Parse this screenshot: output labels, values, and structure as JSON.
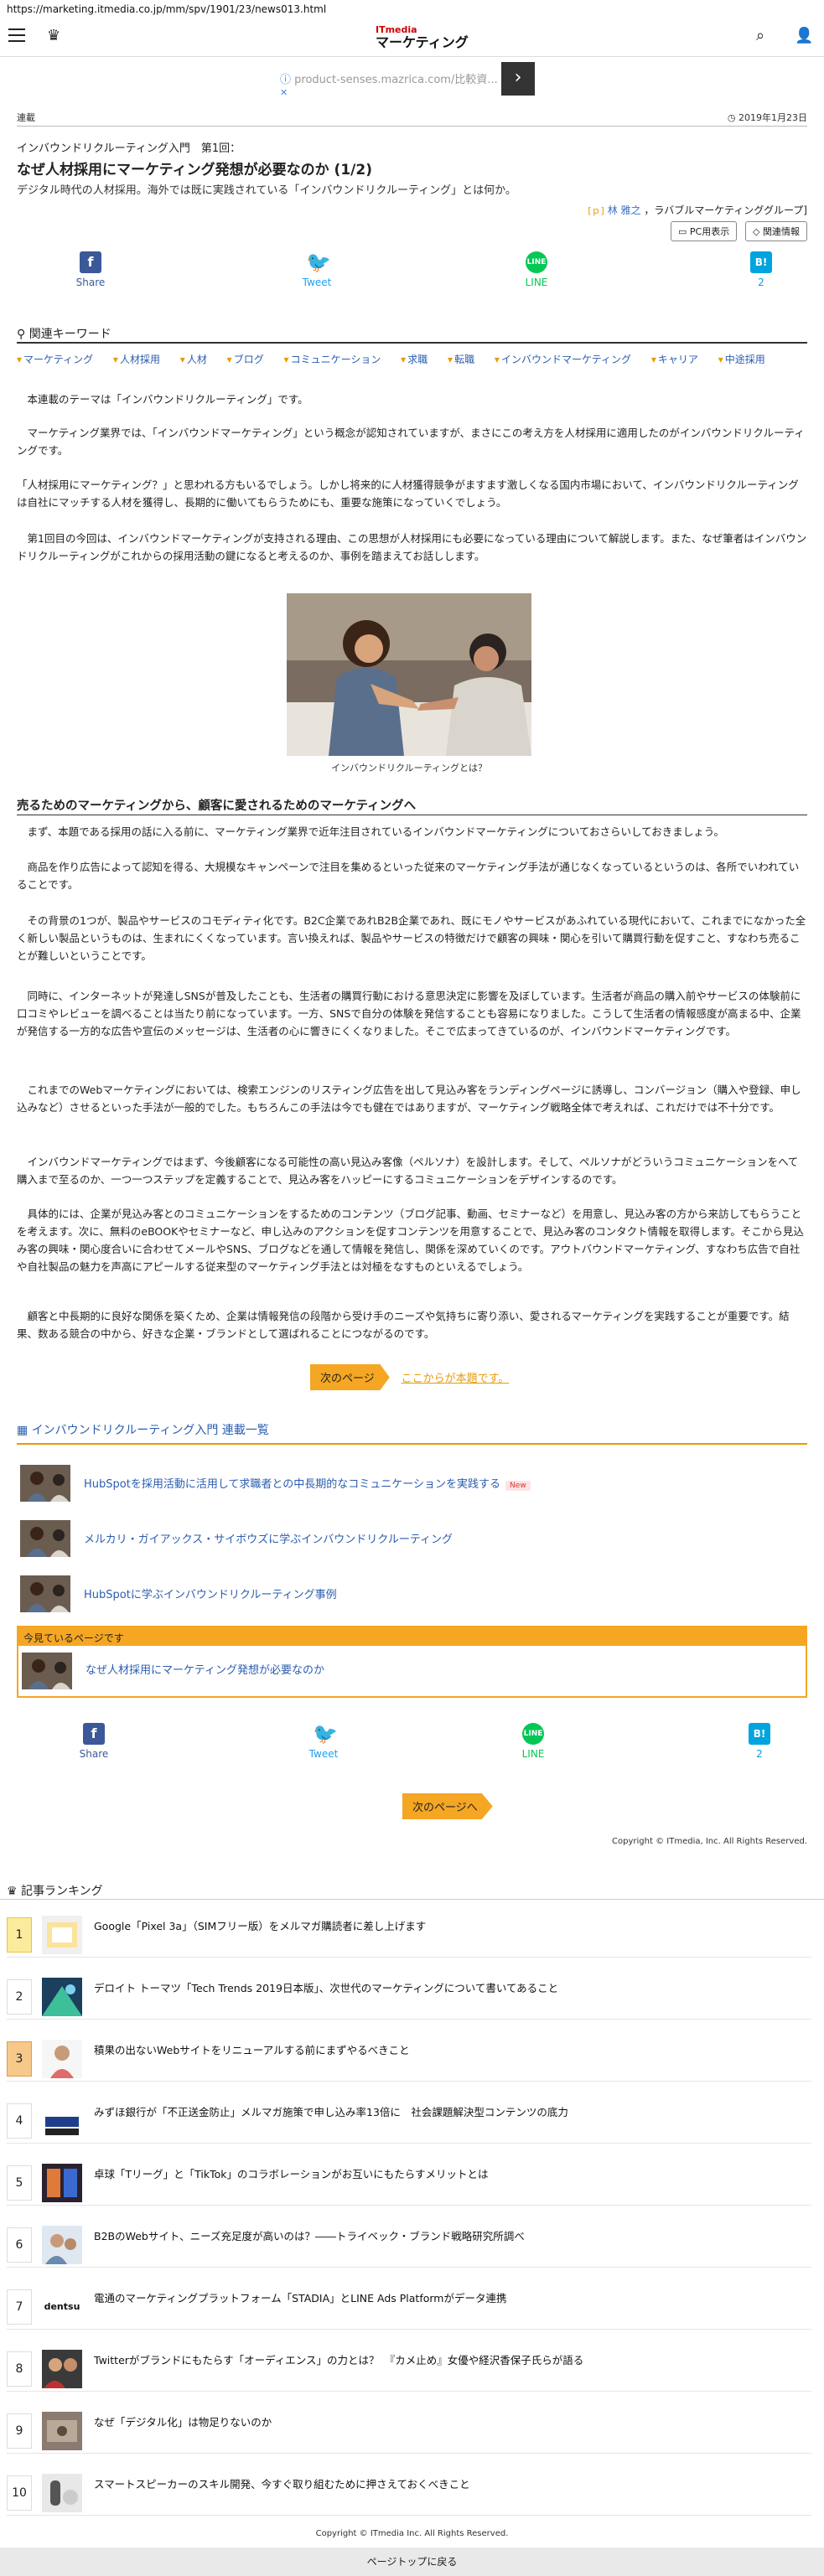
{
  "browser": {
    "url": "https://marketing.itmedia.co.jp/mm/spv/1901/23/news013.html"
  },
  "header": {
    "logo_top": "ITmedia",
    "logo_main": "マーケティング"
  },
  "ad": {
    "text": "product-senses.mazrica.com/比較資...",
    "info": "ⓘ",
    "close": "✕"
  },
  "meta": {
    "category": "連載",
    "date": "2019年1月23日"
  },
  "article": {
    "series": "インバウンドリクルーティング入門　第1回：",
    "title": "なぜ人材採用にマーケティング発想が必要なのか (1/2)",
    "subtitle": "デジタル時代の人材採用。海外では既に実践されている「インバウンドリクルーティング」とは何か。",
    "author_tag": "[ｐ]",
    "author": "林 雅之",
    "author_org": "，ラバブルマーケティンググループ]",
    "pc_label": "PC用表示",
    "related_label": "関連情報"
  },
  "share": {
    "facebook": "Share",
    "twitter": "Tweet",
    "line": "LINE",
    "hatena_count": "2"
  },
  "keywords": {
    "title": "関連キーワード",
    "items": [
      "マーケティング",
      "人材採用",
      "人材",
      "ブログ",
      "コミュニケーション",
      "求職",
      "転職",
      "インバウンドマーケティング",
      "キャリア",
      "中途採用"
    ]
  },
  "body": {
    "p1": "本連載のテーマは「インバウンドリクルーティング」です。",
    "p2": "マーケティング業界では、「インバウンドマーケティング」という概念が認知されていますが、まさにこの考え方を人材採用に適用したのがインバウンドリクルーティングです。",
    "p3": "「人材採用にマーケティング？」と思われる方もいるでしょう。しかし将来的に人材獲得競争がますます激しくなる国内市場において、インバウンドリクルーティングは自社にマッチする人材を獲得し、長期的に働いてもらうためにも、重要な施策になっていくでしょう。",
    "p4": "第1回目の今回は、インバウンドマーケティングが支持される理由、この思想が人材採用にも必要になっている理由について解説します。また、なぜ筆者はインバウンドリクルーティングがこれからの採用活動の鍵になると考えるのか、事例を踏まえてお話しします。",
    "caption": "インバウンドリクルーティングとは？",
    "section": "売るためのマーケティングから、顧客に愛されるためのマーケティングへ",
    "p5": "まず、本題である採用の話に入る前に、マーケティング業界で近年注目されているインバウンドマーケティングについておさらいしておきましょう。",
    "p6": "商品を作り広告によって認知を得る、大規模なキャンペーンで注目を集めるといった従来のマーケティング手法が通じなくなっているというのは、各所でいわれていることです。",
    "p7": "その背景の1つが、製品やサービスのコモディティ化です。B2C企業であれB2B企業であれ、既にモノやサービスがあふれている現代において、これまでになかった全く新しい製品というものは、生まれにくくなっています。言い換えれば、製品やサービスの特徴だけで顧客の興味・関心を引いて購買行動を促すこと、すなわち売ることが難しいということです。",
    "p8": "同時に、インターネットが発達しSNSが普及したことも、生活者の購買行動における意思決定に影響を及ぼしています。生活者が商品の購入前やサービスの体験前に口コミやレビューを調べることは当たり前になっています。一方、SNSで自分の体験を発信することも容易になりました。こうして生活者の情報感度が高まる中、企業が発信する一方的な広告や宣伝のメッセージは、生活者の心に響きにくくなりました。そこで広まってきているのが、インバウンドマーケティングです。",
    "p9": "これまでのWebマーケティングにおいては、検索エンジンのリスティング広告を出して見込み客をランディングページに誘導し、コンバージョン（購入や登録、申し込みなど）させるといった手法が一般的でした。もちろんこの手法は今でも健在ではありますが、マーケティング戦略全体で考えれば、これだけでは不十分です。",
    "p10": "インバウンドマーケティングではまず、今後顧客になる可能性の高い見込み客像（ペルソナ）を設計します。そして、ペルソナがどういうコミュニケーションをへて購入まで至るのか、一つ一つステップを定義することで、見込み客をハッピーにするコミュニケーションをデザインするのです。",
    "p11": "具体的には、企業が見込み客とのコミュニケーションをするためのコンテンツ（ブログ記事、動画、セミナーなど）を用意し、見込み客の方から来訪してもらうことを考えます。次に、無料のeBOOKやセミナーなど、申し込みのアクションを促すコンテンツを用意することで、見込み客のコンタクト情報を取得します。そこから見込み客の興味・関心度合いに合わせてメールやSNS、ブログなどを通して情報を発信し、関係を深めていくのです。アウトバウンドマーケティング、すなわち広告で自社や自社製品の魅力を声高にアピールする従来型のマーケティング手法とは対極をなすものといえるでしょう。",
    "p12": "顧客と中長期的に良好な関係を築くため、企業は情報発信の段階から受け手のニーズや気持ちに寄り添い、愛されるマーケティングを実践することが重要です。結果、数ある競合の中から、好きな企業・ブランドとして選ばれることにつながるのです。",
    "next_label": "次のページ",
    "next_link": "ここからが本題です。"
  },
  "series_list": {
    "title": "インバウンドリクルーティング入門 連載一覧",
    "items": [
      "HubSpotを採用活動に活用して求職者との中長期的なコミュニケーションを実践する",
      "メルカリ・ガイアックス・サイボウズに学ぶインバウンドリクルーティング",
      "HubSpotに学ぶインバウンドリクルーティング事例"
    ],
    "new_label": "New",
    "now_label": "今見ているページです",
    "now_item": "なぜ人材採用にマーケティング発想が必要なのか"
  },
  "share2": {
    "facebook": "Share",
    "twitter": "Tweet",
    "line": "LINE",
    "hatena_count": "2"
  },
  "next2_label": "次のページへ",
  "copyright1": "Copyright © ITmedia, Inc. All Rights Reserved.",
  "ranking": {
    "title": "記事ランキング",
    "items": [
      "Google「Pixel 3a」（SIMフリー版）をメルマガ購読者に差し上げます",
      "デロイト トーマツ「Tech Trends 2019日本版」、次世代のマーケティングについて書いてあること",
      "積果の出ないWebサイトをリニューアルする前にまずやるべきこと",
      "みずほ銀行が「不正送金防止」メルマガ施策で申し込み率13倍に　社会課題解決型コンテンツの底力",
      "卓球「Tリーグ」と「TikTok」のコラボレーションがお互いにもたらすメリットとは",
      "B2BのWebサイト、ニーズ充足度が高いのは？――トライベック・ブランド戦略研究所調べ",
      "電通のマーケティングプラットフォーム「STADIA」とLINE Ads Platformがデータ連携",
      "Twitterがブランドにもたらす「オーディエンス」の力とは？　『カメ止め』女優や経沢香保子氏らが語る",
      "なぜ「デジタル化」は物足りないのか",
      "スマートスピーカーのスキル開発、今すぐ取り組むために押さえておくべきこと"
    ],
    "nums": [
      "1",
      "2",
      "3",
      "4",
      "5",
      "6",
      "7",
      "8",
      "9",
      "10"
    ],
    "thumb7_text": "dentsu"
  },
  "copyright2": "Copyright © ITmedia Inc. All Rights Reserved.",
  "page_top": "ページトップに戻る"
}
